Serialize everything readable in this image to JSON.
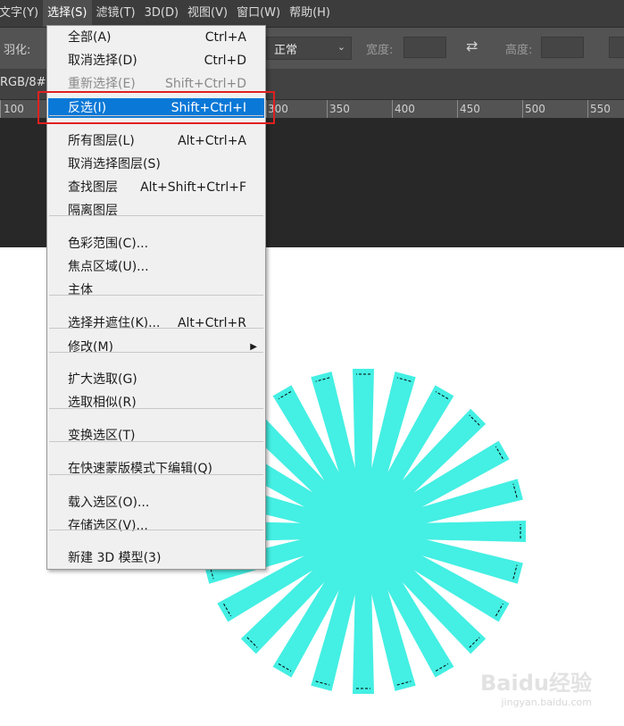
{
  "menubar": {
    "items": [
      "文字(Y)",
      "选择(S)",
      "滤镜(T)",
      "3D(D)",
      "视图(V)",
      "窗口(W)",
      "帮助(H)"
    ],
    "active_index": 1
  },
  "options": {
    "feather_label": "羽化:",
    "style_value": "正常",
    "width_label": "宽度:",
    "height_label": "高度:"
  },
  "doc": {
    "tab_label": "RGB/8#"
  },
  "ruler": {
    "labels": [
      "100",
      "300",
      "350",
      "400",
      "450",
      "500",
      "550"
    ]
  },
  "select_menu": {
    "items": [
      {
        "label": "全部(A)",
        "shortcut": "Ctrl+A"
      },
      {
        "label": "取消选择(D)",
        "shortcut": "Ctrl+D"
      },
      {
        "label": "重新选择(E)",
        "shortcut": "Shift+Ctrl+D",
        "disabled": true
      },
      {
        "label": "反选(I)",
        "shortcut": "Shift+Ctrl+I",
        "highlighted": true
      },
      {
        "label": "所有图层(L)",
        "shortcut": "Alt+Ctrl+A"
      },
      {
        "label": "取消选择图层(S)",
        "shortcut": ""
      },
      {
        "label": "查找图层",
        "shortcut": "Alt+Shift+Ctrl+F"
      },
      {
        "label": "隔离图层",
        "shortcut": ""
      },
      {
        "label": "色彩范围(C)...",
        "shortcut": ""
      },
      {
        "label": "焦点区域(U)...",
        "shortcut": ""
      },
      {
        "label": "主体",
        "shortcut": ""
      },
      {
        "label": "选择并遮住(K)...",
        "shortcut": "Alt+Ctrl+R"
      },
      {
        "label": "修改(M)",
        "shortcut": "",
        "submenu": true
      },
      {
        "label": "扩大选取(G)",
        "shortcut": ""
      },
      {
        "label": "选取相似(R)",
        "shortcut": ""
      },
      {
        "label": "变换选区(T)",
        "shortcut": ""
      },
      {
        "label": "在快速蒙版模式下编辑(Q)",
        "shortcut": ""
      },
      {
        "label": "载入选区(O)...",
        "shortcut": ""
      },
      {
        "label": "存储选区(V)...",
        "shortcut": ""
      },
      {
        "label": "新建 3D 模型(3)",
        "shortcut": ""
      }
    ]
  },
  "canvas": {
    "shape_color": "#44efe3",
    "shape_rays": 24
  },
  "watermark": {
    "text": "Baidu经验",
    "sub": "jingyan.baidu.com"
  }
}
